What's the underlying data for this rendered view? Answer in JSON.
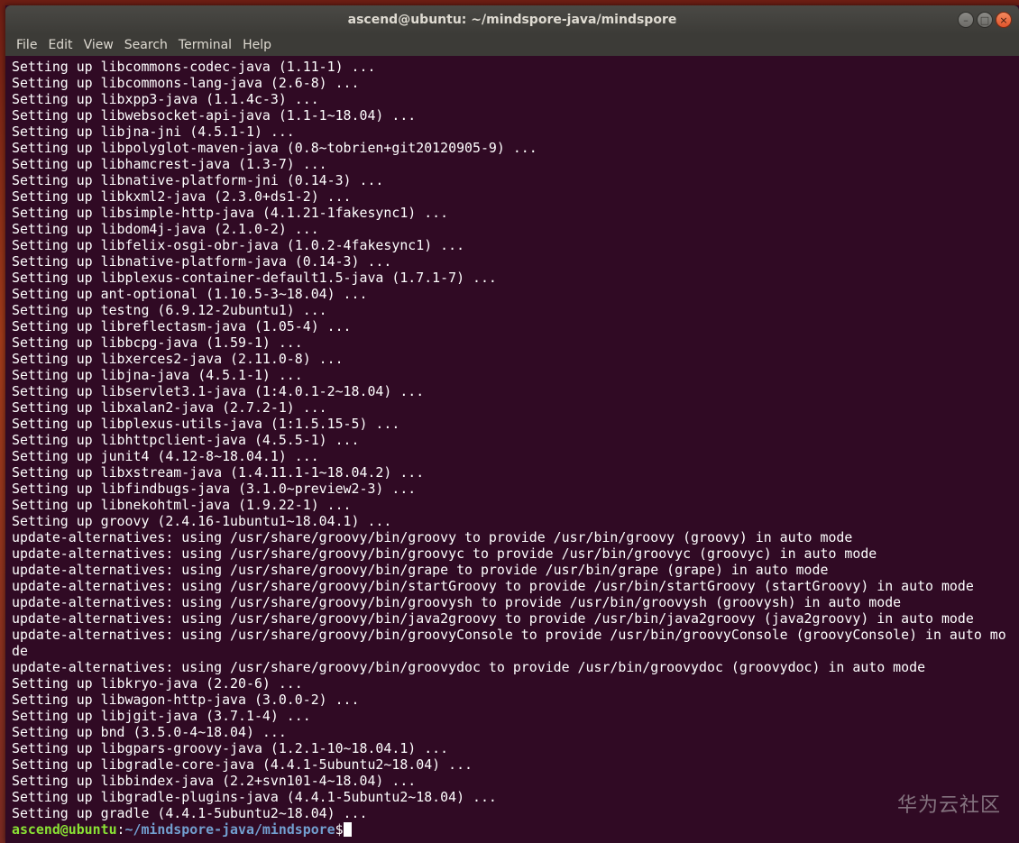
{
  "window": {
    "title": "ascend@ubuntu: ~/mindspore-java/mindspore",
    "controls": {
      "minimize_glyph": "–",
      "maximize_glyph": "□",
      "close_glyph": "×"
    }
  },
  "menubar": {
    "items": [
      "File",
      "Edit",
      "View",
      "Search",
      "Terminal",
      "Help"
    ]
  },
  "terminal": {
    "lines": [
      "Setting up libcommons-codec-java (1.11-1) ...",
      "Setting up libcommons-lang-java (2.6-8) ...",
      "Setting up libxpp3-java (1.1.4c-3) ...",
      "Setting up libwebsocket-api-java (1.1-1~18.04) ...",
      "Setting up libjna-jni (4.5.1-1) ...",
      "Setting up libpolyglot-maven-java (0.8~tobrien+git20120905-9) ...",
      "Setting up libhamcrest-java (1.3-7) ...",
      "Setting up libnative-platform-jni (0.14-3) ...",
      "Setting up libkxml2-java (2.3.0+ds1-2) ...",
      "Setting up libsimple-http-java (4.1.21-1fakesync1) ...",
      "Setting up libdom4j-java (2.1.0-2) ...",
      "Setting up libfelix-osgi-obr-java (1.0.2-4fakesync1) ...",
      "Setting up libnative-platform-java (0.14-3) ...",
      "Setting up libplexus-container-default1.5-java (1.7.1-7) ...",
      "Setting up ant-optional (1.10.5-3~18.04) ...",
      "Setting up testng (6.9.12-2ubuntu1) ...",
      "Setting up libreflectasm-java (1.05-4) ...",
      "Setting up libbcpg-java (1.59-1) ...",
      "Setting up libxerces2-java (2.11.0-8) ...",
      "Setting up libjna-java (4.5.1-1) ...",
      "Setting up libservlet3.1-java (1:4.0.1-2~18.04) ...",
      "Setting up libxalan2-java (2.7.2-1) ...",
      "Setting up libplexus-utils-java (1:1.5.15-5) ...",
      "Setting up libhttpclient-java (4.5.5-1) ...",
      "Setting up junit4 (4.12-8~18.04.1) ...",
      "Setting up libxstream-java (1.4.11.1-1~18.04.2) ...",
      "Setting up libfindbugs-java (3.1.0~preview2-3) ...",
      "Setting up libnekohtml-java (1.9.22-1) ...",
      "Setting up groovy (2.4.16-1ubuntu1~18.04.1) ...",
      "update-alternatives: using /usr/share/groovy/bin/groovy to provide /usr/bin/groovy (groovy) in auto mode",
      "update-alternatives: using /usr/share/groovy/bin/groovyc to provide /usr/bin/groovyc (groovyc) in auto mode",
      "update-alternatives: using /usr/share/groovy/bin/grape to provide /usr/bin/grape (grape) in auto mode",
      "update-alternatives: using /usr/share/groovy/bin/startGroovy to provide /usr/bin/startGroovy (startGroovy) in auto mode",
      "update-alternatives: using /usr/share/groovy/bin/groovysh to provide /usr/bin/groovysh (groovysh) in auto mode",
      "update-alternatives: using /usr/share/groovy/bin/java2groovy to provide /usr/bin/java2groovy (java2groovy) in auto mode",
      "update-alternatives: using /usr/share/groovy/bin/groovyConsole to provide /usr/bin/groovyConsole (groovyConsole) in auto mo",
      "de",
      "update-alternatives: using /usr/share/groovy/bin/groovydoc to provide /usr/bin/groovydoc (groovydoc) in auto mode",
      "Setting up libkryo-java (2.20-6) ...",
      "Setting up libwagon-http-java (3.0.0-2) ...",
      "Setting up libjgit-java (3.7.1-4) ...",
      "Setting up bnd (3.5.0-4~18.04) ...",
      "Setting up libgpars-groovy-java (1.2.1-10~18.04.1) ...",
      "Setting up libgradle-core-java (4.4.1-5ubuntu2~18.04) ...",
      "Setting up libbindex-java (2.2+svn101-4~18.04) ...",
      "Setting up libgradle-plugins-java (4.4.1-5ubuntu2~18.04) ...",
      "Setting up gradle (4.4.1-5ubuntu2~18.04) ..."
    ],
    "prompt": {
      "user_host": "ascend@ubuntu",
      "separator": ":",
      "path": "~/mindspore-java/mindspore",
      "symbol": "$"
    }
  },
  "watermark": "华为云社区",
  "colors": {
    "terminal_bg": "#300a24",
    "titlebar_bg": "#3c3b37",
    "prompt_user": "#8ae234",
    "prompt_path": "#729fcf",
    "close_button": "#e0552c"
  }
}
